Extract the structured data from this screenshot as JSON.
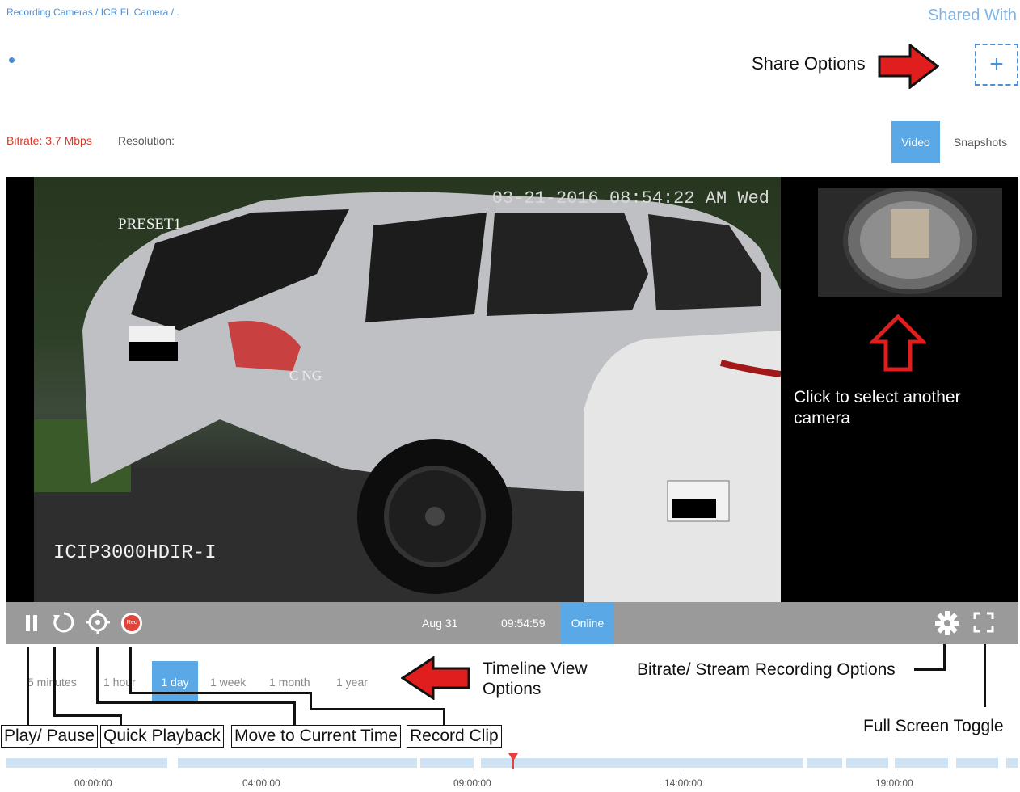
{
  "header": {
    "breadcrumb": "Recording Cameras / ICR FL Camera / .",
    "shared_with": "Shared With",
    "add_share_icon": "+"
  },
  "stream": {
    "bitrate": "Bitrate: 3.7 Mbps",
    "resolution": "Resolution:",
    "tabs": {
      "video": "Video",
      "snapshots": "Snapshots"
    }
  },
  "video": {
    "osd_timestamp": "03-21-2016 08:54:22 AM Wed",
    "osd_preset": "PRESET1",
    "osd_camera": "ICIP3000HDIR-I",
    "plate_text": "C NG"
  },
  "controls": {
    "date": "Aug 31",
    "time": "09:54:59",
    "status": "Online",
    "icons": [
      "pause-icon",
      "quick-playback-icon",
      "crosshair-icon",
      "record-icon",
      "gear-icon",
      "fullscreen-icon"
    ],
    "record_icon_text": "Rec"
  },
  "timeline_options": [
    "5 minutes",
    "1 hour",
    "1 day",
    "1 week",
    "1 month",
    "1 year"
  ],
  "timeline_active": "1 day",
  "timeline": {
    "times": [
      "00:00:00",
      "04:00:00",
      "09:00:00",
      "14:00:00",
      "19:00:00"
    ],
    "playhead_color": "#e0443a"
  },
  "annotations": {
    "share_options": "Share Options",
    "select_camera_line1": "Click to select another",
    "select_camera_line2": "camera",
    "timeline_view_line1": "Timeline View",
    "timeline_view_line2": "Options",
    "bitrate_stream": "Bitrate/ Stream Recording Options",
    "fullscreen_toggle": "Full Screen Toggle",
    "play_pause": "Play/ Pause",
    "quick_playback": "Quick Playback",
    "move_to_current": "Move to Current Time",
    "record_clip": "Record Clip"
  },
  "colors": {
    "accent": "#5aa9e6",
    "bitrate": "#d9382b",
    "arrow": "#e01e1e"
  }
}
